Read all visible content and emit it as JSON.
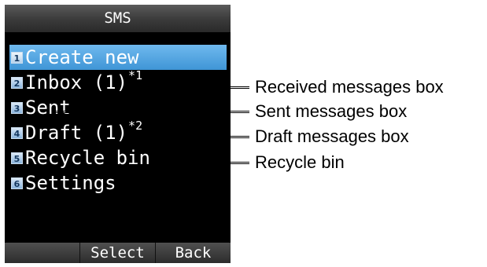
{
  "screen": {
    "title": "SMS",
    "menu": [
      {
        "number": "1",
        "label": "Create new",
        "note": ""
      },
      {
        "number": "2",
        "label": "Inbox (1)",
        "note": "*1"
      },
      {
        "number": "3",
        "label": "Sent",
        "note": ""
      },
      {
        "number": "4",
        "label": "Draft (1)",
        "note": "*2"
      },
      {
        "number": "5",
        "label": "Recycle bin",
        "note": ""
      },
      {
        "number": "6",
        "label": "Settings",
        "note": ""
      }
    ],
    "selected_index": 0,
    "softkeys": {
      "left": "",
      "center": "Select",
      "right": "Back"
    }
  },
  "callouts": {
    "inbox": "Received messages box",
    "sent": "Sent messages box",
    "draft": "Draft messages box",
    "recycle": "Recycle bin"
  },
  "colors": {
    "selected_highlight": "#4fa6e4",
    "screen_background": "#000000"
  }
}
